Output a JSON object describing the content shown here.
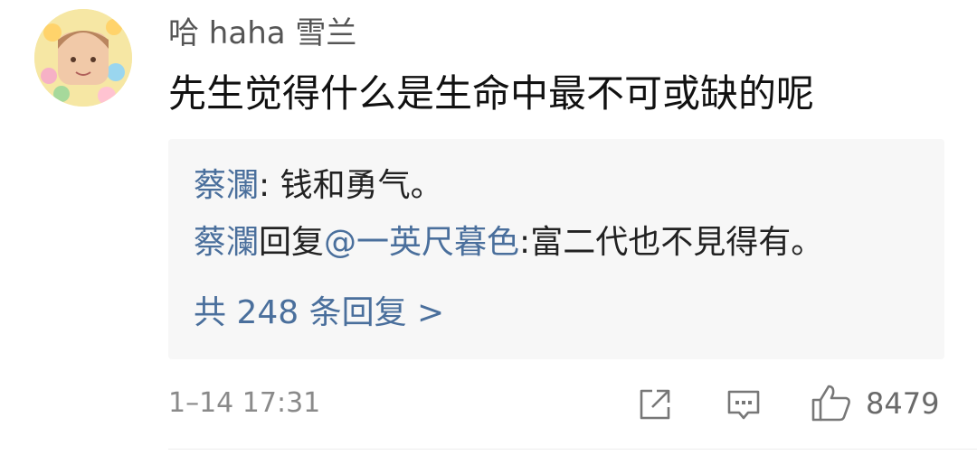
{
  "comment": {
    "username": "哈 haha 雪兰",
    "text": "先生觉得什么是生命中最不可或缺的呢",
    "avatar": "avatar-image",
    "replies": [
      {
        "author": "蔡瀾",
        "separator": ": ",
        "text": "钱和勇气。"
      },
      {
        "author": "蔡瀾",
        "verb": "回复",
        "mention": "@一英尺暮色",
        "separator": ":",
        "text": "富二代也不見得有。"
      }
    ],
    "more_replies_label": "共 248 条回复 >",
    "timestamp": "1–14 17:31",
    "like_count": "8479",
    "icons": {
      "share": "share-icon",
      "reply": "comment-icon",
      "like": "thumbs-up-icon"
    },
    "colors": {
      "link_blue": "#4a6f9c",
      "reply_bg": "#f7f7f7",
      "meta_gray": "#8a8a8a"
    }
  }
}
